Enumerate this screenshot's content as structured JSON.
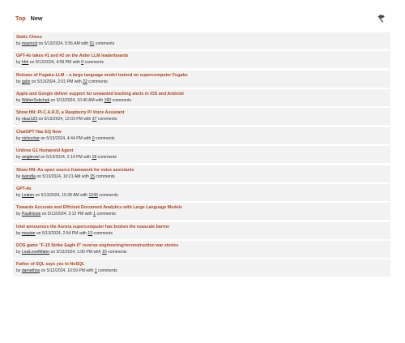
{
  "tabs": {
    "top": "Top",
    "new": "New"
  },
  "toolbar": {
    "tool_icon": "hammer-icon"
  },
  "labels": {
    "by": "by",
    "on": "on",
    "with": "with",
    "comments": "comments"
  },
  "stories": [
    {
      "title": "Static Chess",
      "author": "maxmcd",
      "date": "5/13/2024, 5:56 AM",
      "comments": "51"
    },
    {
      "title": "GPT-4o takes #1 and #2 on the Aider LLM leaderboards",
      "author": "hhh",
      "date": "5/13/2024, 4:09 PM",
      "comments": "0"
    },
    {
      "title": "Release of Fugaku-LLM – a large language model trained on supercomputer Fugaku",
      "author": "gslin",
      "date": "5/13/2024, 2:01 PM",
      "comments": "22"
    },
    {
      "title": "Apple and Google deliver support for unwanted tracking alerts in iOS and Android",
      "author": "WalterSobchak",
      "date": "5/13/2024, 10:46 AM",
      "comments": "160"
    },
    {
      "title": "Show HN: PI-C.A.R.D, a Raspberry Pi Voice Assistant",
      "author": "nkaz123",
      "date": "5/13/2024, 12:03 PM",
      "comments": "37"
    },
    {
      "title": "ChatGPT Has EQ Now",
      "author": "nichochar",
      "date": "5/13/2024, 4:44 PM",
      "comments": "0"
    },
    {
      "title": "Unitree G1 Humanoid Agent",
      "author": "anigbrowl",
      "date": "5/13/2024, 2:14 PM",
      "comments": "18"
    },
    {
      "title": "Show HN: An open source framework for voice assistants",
      "author": "kwindla",
      "date": "5/13/2024, 10:21 AM",
      "comments": "25"
    },
    {
      "title": "GPT-4o",
      "author": "Lealen",
      "date": "5/13/2024, 10:28 AM",
      "comments": "1243"
    },
    {
      "title": "Towards Accurate and Efficient Document Analytics with Large Language Models",
      "author": "PaulHoule",
      "date": "5/13/2024, 3:12 PM",
      "comments": "1"
    },
    {
      "title": "Intel announces the Aurora supercomputer has broken the exascale barrier",
      "author": "mepian",
      "date": "5/13/2024, 2:54 PM",
      "comments": "13"
    },
    {
      "title": "DOS game \"F-15 Strike Eagle II\" reverse engineering/reconstruction war stories",
      "author": "LowLevelMahn",
      "date": "5/13/2024, 1:00 PM",
      "comments": "10"
    },
    {
      "title": "Father of SQL says yes to NoSQL",
      "author": "damethos",
      "date": "5/12/2024, 10:59 PM",
      "comments": "1"
    }
  ]
}
